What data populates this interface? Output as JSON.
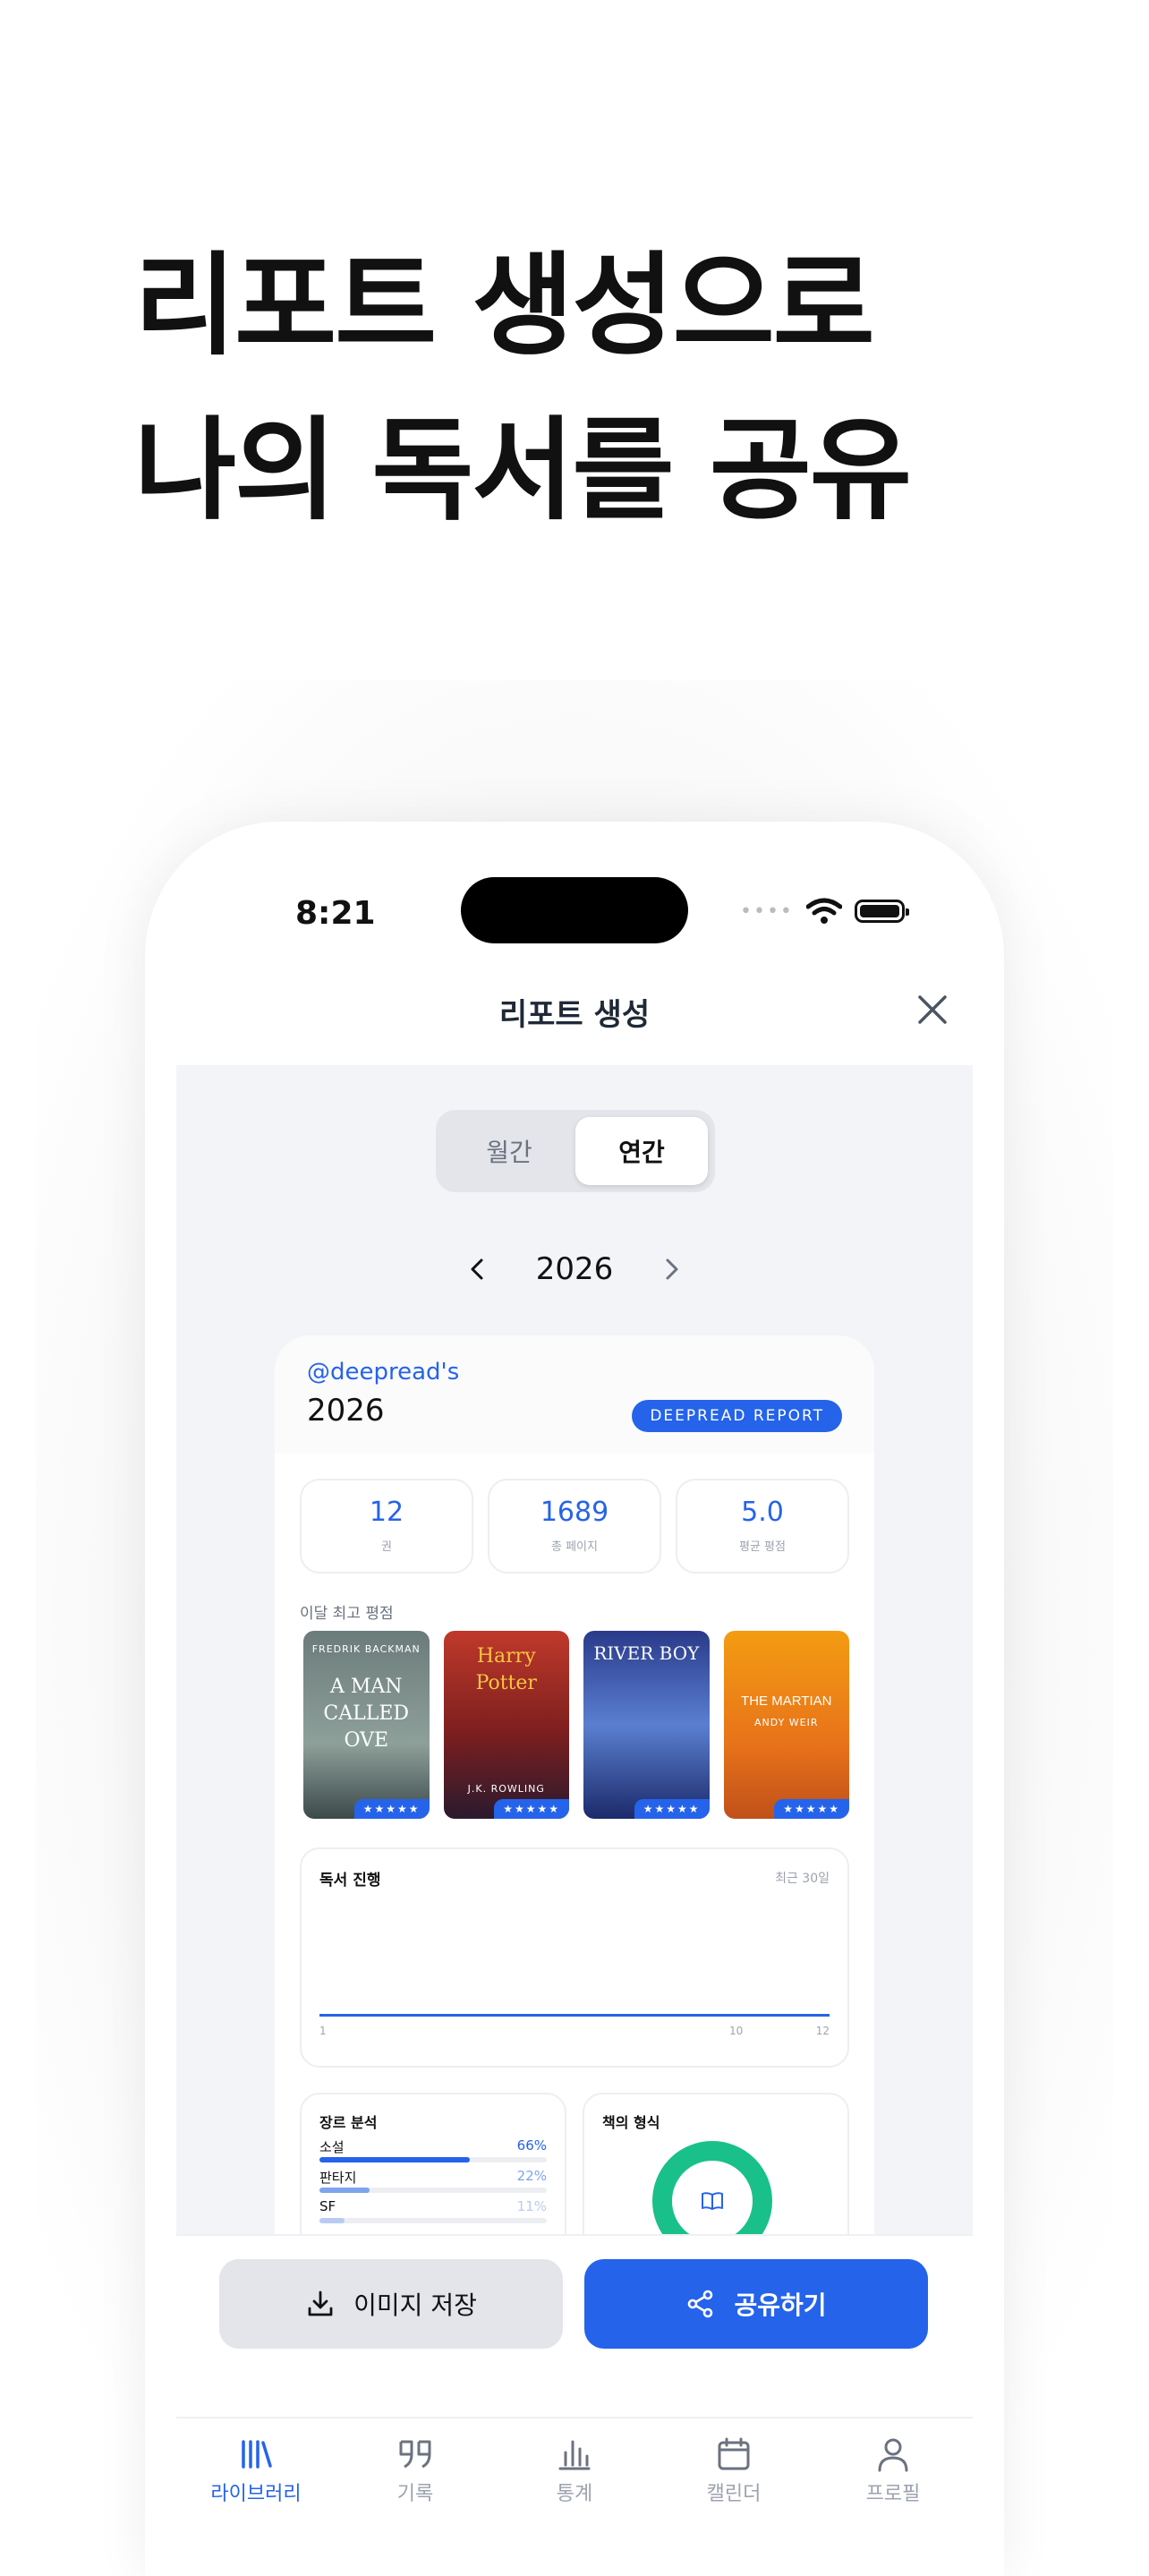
{
  "headline": {
    "line1": "리포트 생성으로",
    "line2": "나의 독서를 공유"
  },
  "status_bar": {
    "time": "8:21"
  },
  "nav": {
    "title": "리포트 생성"
  },
  "segment": {
    "options": [
      "월간",
      "연간"
    ],
    "selected": "연간"
  },
  "year_selector": {
    "year": "2026"
  },
  "report": {
    "handle": "@deepread's",
    "year": "2026",
    "badge": "DEEPREAD REPORT",
    "stats": [
      {
        "value": "12",
        "label": "권"
      },
      {
        "value": "1689",
        "label": "총 페이지"
      },
      {
        "value": "5.0",
        "label": "평균 평점"
      }
    ],
    "top_rated_label": "이달 최고 평점",
    "books": [
      {
        "author": "FREDRIK BACKMAN",
        "title": "A MAN CALLED OVE",
        "stars": "★★★★★"
      },
      {
        "author": "J.K. ROWLING",
        "title": "Harry Potter",
        "stars": "★★★★★"
      },
      {
        "author": "",
        "title": "RIVER BOY",
        "stars": "★★★★★"
      },
      {
        "author": "ANDY WEIR",
        "title": "THE MARTIAN",
        "stars": "★★★★★"
      }
    ],
    "progress": {
      "title": "독서 진행",
      "subtitle": "최근 30일",
      "ticks": [
        "1",
        "10",
        "12"
      ]
    },
    "genre": {
      "title": "장르 분석",
      "items": [
        {
          "name": "소설",
          "percent": "66%",
          "value": 66
        },
        {
          "name": "판타지",
          "percent": "22%",
          "value": 22
        },
        {
          "name": "SF",
          "percent": "11%",
          "value": 11
        }
      ]
    },
    "format": {
      "title": "책의 형식"
    }
  },
  "actions": {
    "save_label": "이미지 저장",
    "share_label": "공유하기"
  },
  "tabbar": {
    "items": [
      {
        "label": "라이브러리",
        "icon": "library-icon"
      },
      {
        "label": "기록",
        "icon": "quote-icon"
      },
      {
        "label": "통계",
        "icon": "chart-icon"
      },
      {
        "label": "캘린더",
        "icon": "calendar-icon"
      },
      {
        "label": "프로필",
        "icon": "profile-icon"
      }
    ]
  },
  "colors": {
    "accent": "#2563eb",
    "donut": "#19c08a",
    "background": "#f2f4f7"
  }
}
